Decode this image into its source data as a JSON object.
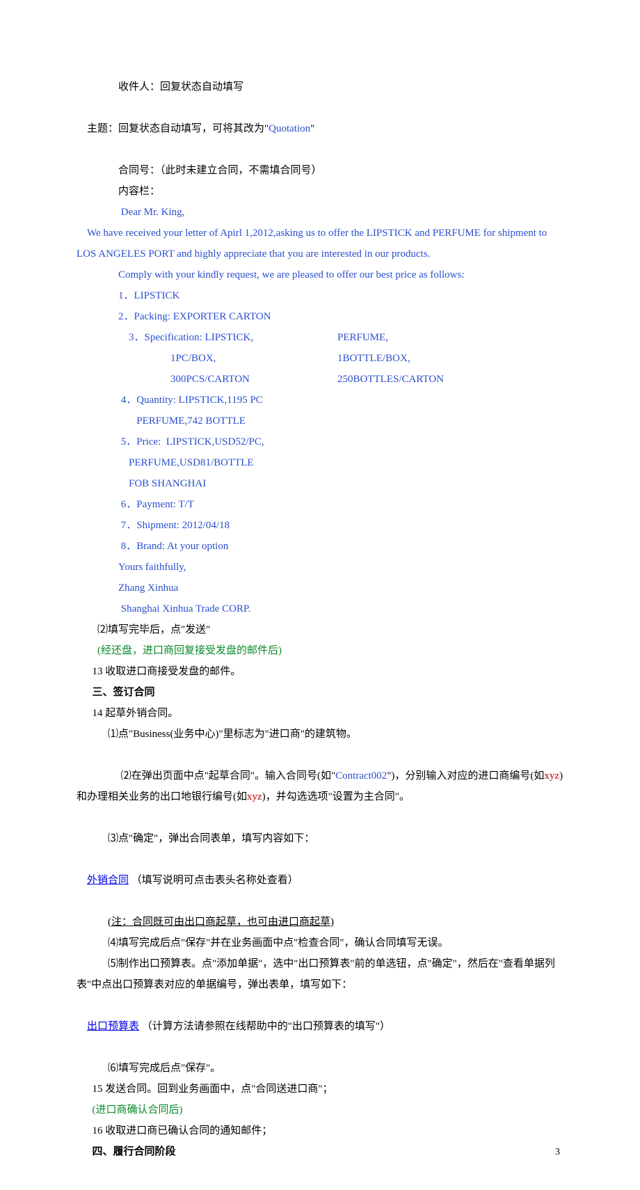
{
  "lines": {
    "l1": "收件人：回复状态自动填写",
    "l2a": "主题：回复状态自动填写，可将其改为\"",
    "l2b": "Quotation",
    "l2c": "\"",
    "l3": "合同号：（此时未建立合同，不需填合同号）",
    "l4": "内容栏：",
    "l5": " Dear Mr. King,",
    "l6": "    We have received your letter of Apirl 1,2012,asking us to offer the LIPSTICK and PERFUME for shipment to LOS ANGELES PORT and highly appreciate that you are interested in our products.",
    "l7": "Comply with your kindly request, we are pleased to offer our best price as follows:",
    "l8": "1．LIPSTICK",
    "l9": "2．Packing: EXPORTER CARTON",
    "s1l": " 3．Specification: LIPSTICK,",
    "s1r": "PERFUME,",
    "s2l": "1PC/BOX,",
    "s2r": "1BOTTLE/BOX,",
    "s3l": "300PCS/CARTON",
    "s3r": "250BOTTLES/CARTON",
    "l13": " 4．Quantity: LIPSTICK,1195 PC",
    "l14": "       PERFUME,742 BOTTLE",
    "l15": " 5．Price:  LIPSTICK,USD52/PC,",
    "l16": "    PERFUME,USD81/BOTTLE",
    "l17": "    FOB SHANGHAI",
    "l18": " 6．Payment: T/T",
    "l19": " 7．Shipment: 2012/04/18",
    "l20": " 8．Brand: At your option",
    "l21": "Yours faithfully,",
    "l22": "Zhang Xinhua",
    "l23": " Shanghai Xinhua Trade CORP.",
    "l24": "⑵填写完毕后，点\"发送\"",
    "l25": "(经还盘，进口商回复接受发盘的邮件后)",
    "l26": "13 收取进口商接受发盘的邮件。",
    "l27": "三、签订合同",
    "l28": "14 起草外销合同。",
    "l29": "⑴点\"Business(业务中心)\"里标志为\"进口商\"的建筑物。",
    "l30a": " ⑵在弹出页面中点\"起草合同\"。输入合同号(如\"",
    "l30b": "Contract002",
    "l30c": "\")，分别输入对应的进口商编号(如",
    "l30d": "xyz",
    "l30e": ")和办理相关业务的出口地银行编号(如",
    "l30f": "xyz",
    "l30g": ")，并勾选选项\"设置为主合同\"。",
    "l31": "⑶点\"确定\"，弹出合同表单，填写内容如下：",
    "l32link": "外销合同",
    "l32after": " （填写说明可点击表头名称处查看）",
    "l33": "(注：合同既可由出口商起草，也可由进口商起草)",
    "l34": "⑷填写完成后点\"保存\"并在业务画面中点\"检查合同\"，确认合同填写无误。",
    "l35": "⑸制作出口预算表。点\"添加单据\"，选中\"出口预算表\"前的单选钮，点\"确定\"，然后在\"查看单据列表\"中点出口预算表对应的单据编号，弹出表单，填写如下：",
    "l36link": "出口预算表",
    "l36after": " （计算方法请参照在线帮助中的\"出口预算表的填写\"）",
    "l37": "⑹填写完成后点\"保存\"。",
    "l38": "15 发送合同。回到业务画面中，点\"合同送进口商\"；",
    "l39": "(进口商确认合同后)",
    "l40": "16 收取进口商已确认合同的通知邮件；",
    "l41": "四、履行合同阶段"
  },
  "pageNumber": "3"
}
